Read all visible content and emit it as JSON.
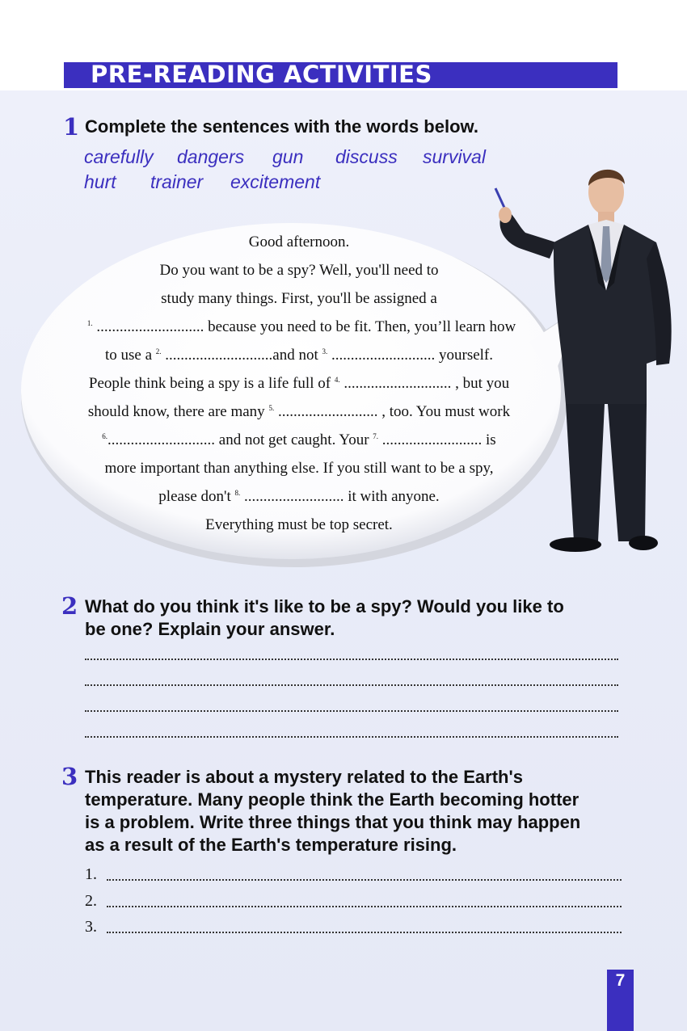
{
  "header": {
    "title": "PRE-READING ACTIVITIES"
  },
  "q1": {
    "number": "1",
    "text": "Complete the sentences with the words below.",
    "words": [
      "carefully",
      "dangers",
      "gun",
      "discuss",
      "survival",
      "hurt",
      "trainer",
      "excitement"
    ]
  },
  "bubble": {
    "l1": "Good afternoon.",
    "l2": "Do you want to be a spy? Well, you'll need to",
    "l3": "study many things. First, you'll be assigned a",
    "l4_n": "1.",
    "l4_t": " ............................ because you need to be fit. Then, you’ll learn how",
    "l5_a": "to use a ",
    "l5_n1": "2.",
    "l5_b": " ............................and not ",
    "l5_n2": "3.",
    "l5_c": " ........................... yourself.",
    "l6_a": "People think being a spy is a life full of ",
    "l6_n": "4.",
    "l6_b": " ............................ , but you",
    "l7_a": "should know, there are many ",
    "l7_n": "5.",
    "l7_b": " .......................... , too. You must work",
    "l8_n": "6.",
    "l8_a": "............................ and not get caught. Your ",
    "l8_n2": "7.",
    "l8_b": " .......................... is",
    "l9": "more important than anything else. If you still want to be a spy,",
    "l10_a": "please don't ",
    "l10_n": "8.",
    "l10_b": " .......................... it with anyone.",
    "l11": "Everything must be top secret."
  },
  "q2": {
    "number": "2",
    "line1": "What do you think it's like to be a spy? Would you like to",
    "line2": "be one? Explain your answer."
  },
  "q3": {
    "number": "3",
    "line1": "This reader is about a mystery related to the Earth's",
    "line2": "temperature. Many people think the Earth becoming hotter",
    "line3": "is a problem. Write three things that you think may happen",
    "line4": "as a result of the Earth's temperature rising.",
    "items": [
      "1.",
      "2.",
      "3."
    ]
  },
  "page_number": "7",
  "colors": {
    "accent": "#3b2fbf"
  }
}
